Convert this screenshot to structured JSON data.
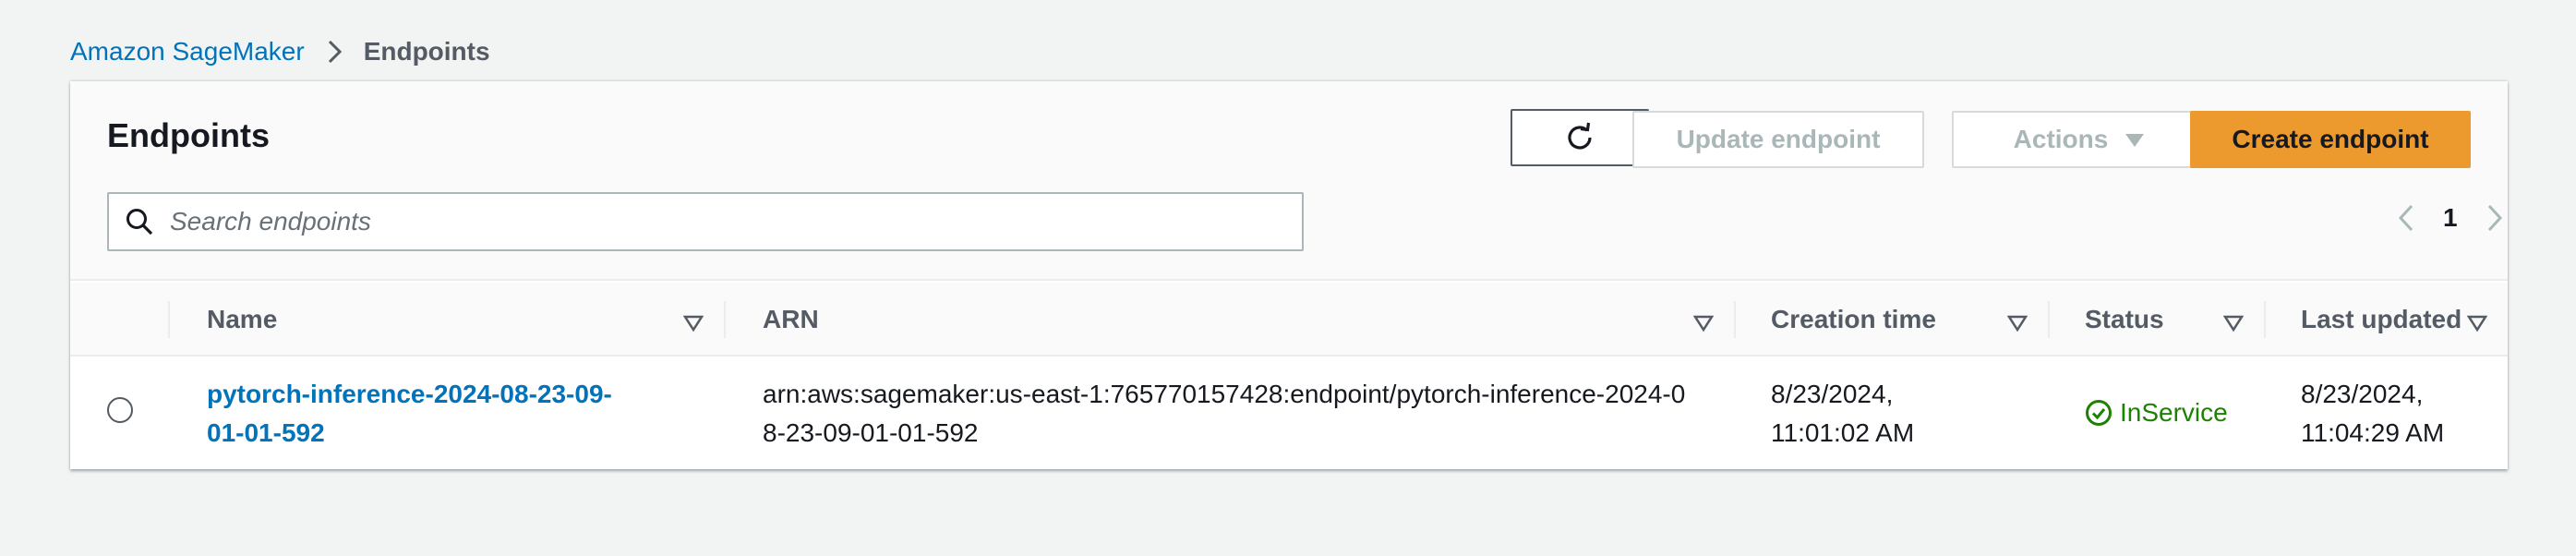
{
  "breadcrumb": {
    "root": "Amazon SageMaker",
    "current": "Endpoints"
  },
  "panel": {
    "title": "Endpoints",
    "buttons": {
      "refresh_icon": "refresh-icon",
      "update": "Update endpoint",
      "actions": "Actions",
      "create": "Create endpoint"
    },
    "search": {
      "placeholder": "Search endpoints"
    },
    "pagination": {
      "current_page": "1"
    }
  },
  "table": {
    "columns": [
      "Name",
      "ARN",
      "Creation time",
      "Status",
      "Last updated"
    ],
    "rows": [
      {
        "name": "pytorch-inference-2024-08-23-09-01-01-592",
        "arn": "arn:aws:sagemaker:us-east-1:765770157428:endpoint/pytorch-inference-2024-08-23-09-01-01-592",
        "creation_time": "8/23/2024, 11:01:02 AM",
        "status": "InService",
        "last_updated": "8/23/2024, 11:04:29 AM"
      }
    ]
  },
  "colors": {
    "link": "#0073bb",
    "primary_button": "#ec9a2e",
    "status_ok": "#1d8102",
    "page_bg": "#f2f3f3"
  }
}
